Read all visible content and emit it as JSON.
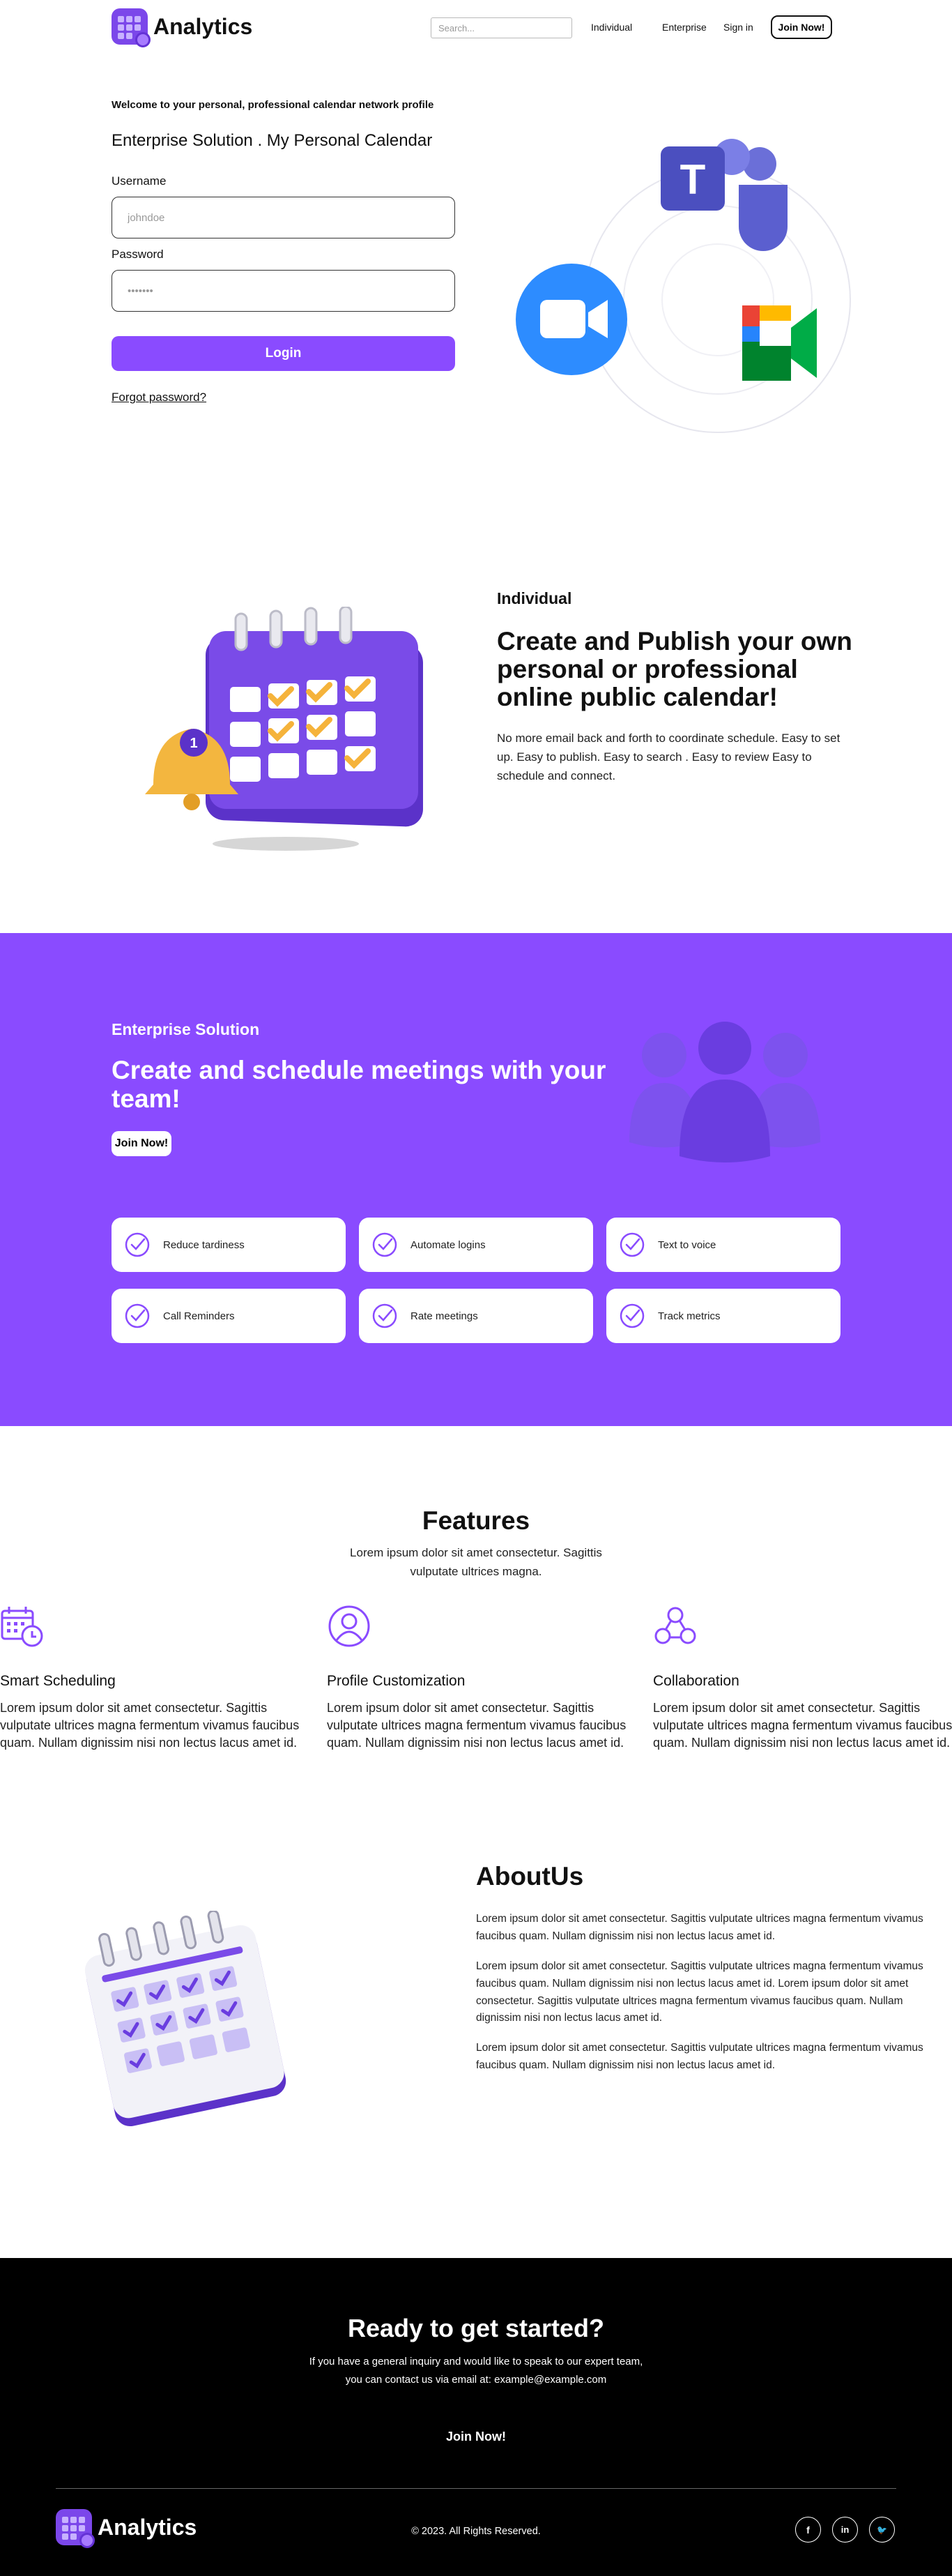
{
  "header": {
    "brand": "Analytics",
    "search_placeholder": "Search...",
    "nav": [
      "Individual",
      "Enterprise",
      "Sign in"
    ],
    "join": "Join Now!"
  },
  "login": {
    "welcome": "Welcome to your personal, professional calendar network profile",
    "subtitle": "Enterprise Solution . My Personal Calendar",
    "username_label": "Username",
    "username_placeholder": "johndoe",
    "password_label": "Password",
    "password_placeholder": "•••••••",
    "login_button": "Login",
    "forgot": "Forgot password?"
  },
  "individual": {
    "label": "Individual",
    "title": "Create and Publish your own personal or professional online public calendar!",
    "text": "No more email back and forth to coordinate schedule. Easy to set up. Easy to publish. Easy to search . Easy to review Easy to schedule and connect."
  },
  "enterprise": {
    "label": "Enterprise Solution",
    "title": "Create and schedule meetings with your team!",
    "join": "Join Now!",
    "cards": [
      "Reduce tardiness",
      "Automate logins",
      "Text to voice",
      "Call Reminders",
      "Rate meetings",
      "Track metrics"
    ]
  },
  "features": {
    "title": "Features",
    "subtitle": "Lorem ipsum dolor sit amet consectetur. Sagittis vulputate ultrices magna.",
    "items": [
      {
        "name": "Smart Scheduling",
        "icon": "calendar-clock-icon",
        "desc": "Lorem ipsum dolor sit amet consectetur. Sagittis vulputate ultrices magna fermentum vivamus faucibus quam. Nullam dignissim nisi non lectus lacus amet id."
      },
      {
        "name": "Profile Customization",
        "icon": "user-circle-icon",
        "desc": "Lorem ipsum dolor sit amet consectetur. Sagittis vulputate ultrices magna fermentum vivamus faucibus quam. Nullam dignissim nisi non lectus lacus amet id."
      },
      {
        "name": "Collaboration",
        "icon": "collaboration-icon",
        "desc": "Lorem ipsum dolor sit amet consectetur. Sagittis vulputate ultrices magna fermentum vivamus faucibus quam. Nullam dignissim nisi non lectus lacus amet id."
      }
    ]
  },
  "about": {
    "title": "AboutUs",
    "paragraphs": [
      "Lorem ipsum dolor sit amet consectetur. Sagittis vulputate ultrices magna fermentum vivamus faucibus quam. Nullam dignissim nisi non lectus lacus amet id.",
      "Lorem ipsum dolor sit amet consectetur. Sagittis vulputate ultrices magna fermentum vivamus faucibus quam. Nullam dignissim nisi non lectus lacus amet id. Lorem ipsum dolor sit amet consectetur. Sagittis vulputate ultrices magna fermentum vivamus faucibus quam. Nullam dignissim nisi non lectus lacus amet id.",
      "Lorem ipsum dolor sit amet consectetur. Sagittis vulputate ultrices magna fermentum vivamus faucibus quam. Nullam dignissim nisi non lectus lacus amet id."
    ]
  },
  "footer": {
    "cta_title": "Ready to get started?",
    "cta_line1": "If you have a general inquiry and would like to speak to our expert team,",
    "cta_line2": "you can contact us via email at: example@example.com",
    "cta_join": "Join Now!",
    "brand": "Analytics",
    "copyright": "© 2023. All Rights Reserved.",
    "social": [
      {
        "icon": "facebook-icon",
        "glyph": "f"
      },
      {
        "icon": "linkedin-icon",
        "glyph": "in"
      },
      {
        "icon": "twitter-icon",
        "glyph": "🐦"
      }
    ]
  },
  "colors": {
    "brand": "#8a4bff",
    "brand_dark": "#5b32c9",
    "footer_bg": "#000000"
  }
}
